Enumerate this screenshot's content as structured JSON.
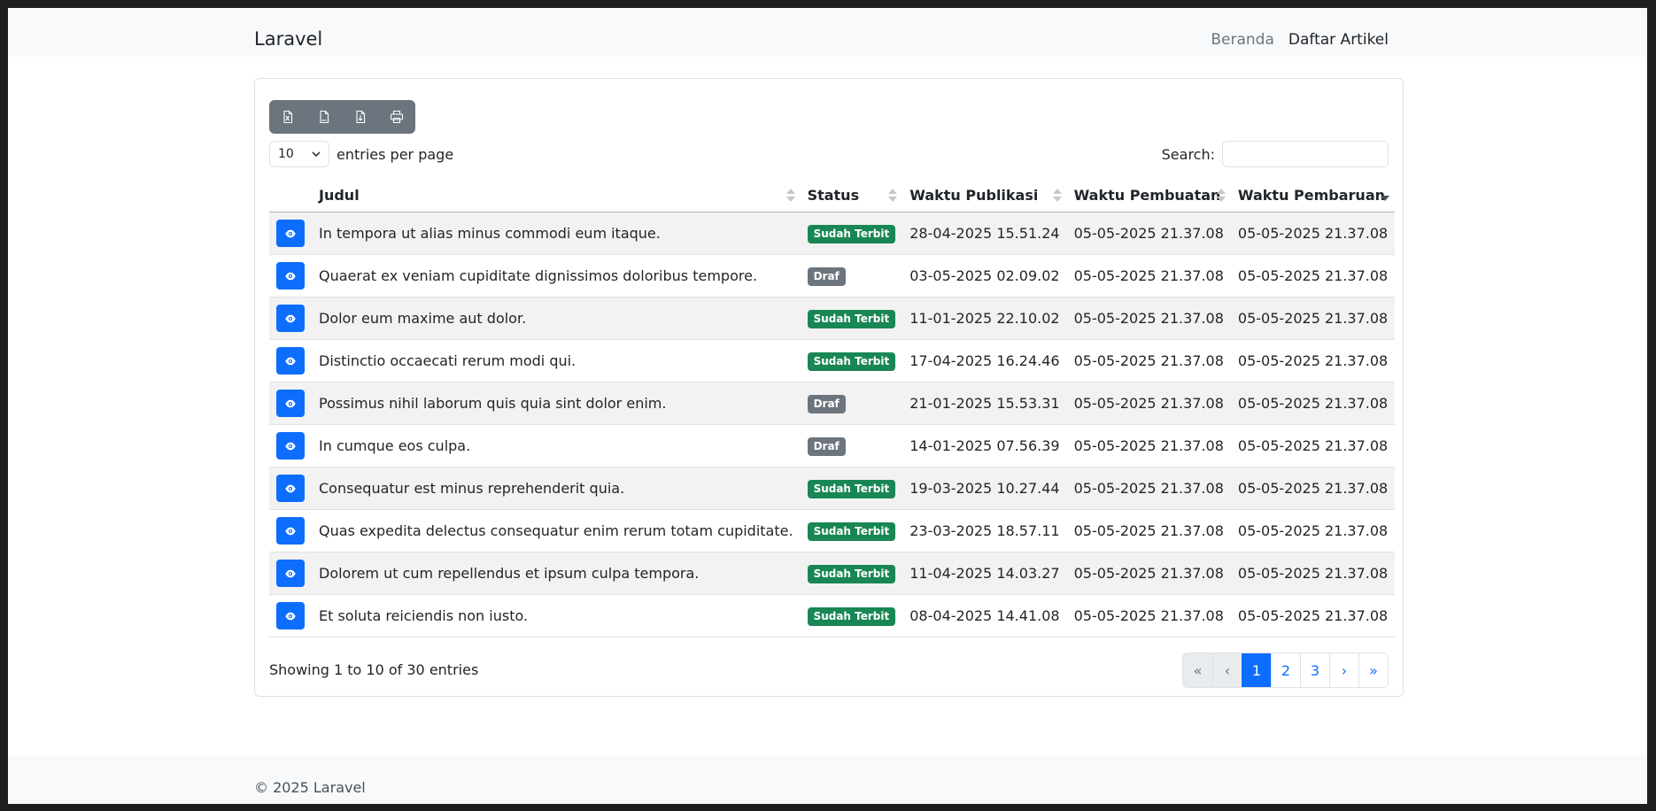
{
  "navbar": {
    "brand": "Laravel",
    "links": [
      {
        "label": "Beranda",
        "active": false
      },
      {
        "label": "Daftar Artikel",
        "active": true
      }
    ]
  },
  "toolbar": {
    "buttons": [
      {
        "icon": "excel-file-icon"
      },
      {
        "icon": "csv-file-icon"
      },
      {
        "icon": "pdf-file-icon"
      },
      {
        "icon": "print-icon"
      }
    ]
  },
  "length": {
    "value": "10",
    "label": "entries per page"
  },
  "search": {
    "label": "Search:",
    "value": "",
    "placeholder": ""
  },
  "table": {
    "columns": [
      {
        "label": "",
        "sortable": false
      },
      {
        "label": "Judul",
        "sortable": true
      },
      {
        "label": "Status",
        "sortable": true
      },
      {
        "label": "Waktu Publikasi",
        "sortable": true
      },
      {
        "label": "Waktu Pembuatan",
        "sortable": true
      },
      {
        "label": "Waktu Pembaruan",
        "sortable": true,
        "sorted": "desc"
      }
    ],
    "rows": [
      {
        "judul": "In tempora ut alias minus commodi eum itaque.",
        "status": "Sudah Terbit",
        "publikasi": "28-04-2025 15.51.24",
        "pembuatan": "05-05-2025 21.37.08",
        "pembaruan": "05-05-2025 21.37.08"
      },
      {
        "judul": "Quaerat ex veniam cupiditate dignissimos doloribus tempore.",
        "status": "Draf",
        "publikasi": "03-05-2025 02.09.02",
        "pembuatan": "05-05-2025 21.37.08",
        "pembaruan": "05-05-2025 21.37.08"
      },
      {
        "judul": "Dolor eum maxime aut dolor.",
        "status": "Sudah Terbit",
        "publikasi": "11-01-2025 22.10.02",
        "pembuatan": "05-05-2025 21.37.08",
        "pembaruan": "05-05-2025 21.37.08"
      },
      {
        "judul": "Distinctio occaecati rerum modi qui.",
        "status": "Sudah Terbit",
        "publikasi": "17-04-2025 16.24.46",
        "pembuatan": "05-05-2025 21.37.08",
        "pembaruan": "05-05-2025 21.37.08"
      },
      {
        "judul": "Possimus nihil laborum quis quia sint dolor enim.",
        "status": "Draf",
        "publikasi": "21-01-2025 15.53.31",
        "pembuatan": "05-05-2025 21.37.08",
        "pembaruan": "05-05-2025 21.37.08"
      },
      {
        "judul": "In cumque eos culpa.",
        "status": "Draf",
        "publikasi": "14-01-2025 07.56.39",
        "pembuatan": "05-05-2025 21.37.08",
        "pembaruan": "05-05-2025 21.37.08"
      },
      {
        "judul": "Consequatur est minus reprehenderit quia.",
        "status": "Sudah Terbit",
        "publikasi": "19-03-2025 10.27.44",
        "pembuatan": "05-05-2025 21.37.08",
        "pembaruan": "05-05-2025 21.37.08"
      },
      {
        "judul": "Quas expedita delectus consequatur enim rerum totam cupiditate.",
        "status": "Sudah Terbit",
        "publikasi": "23-03-2025 18.57.11",
        "pembuatan": "05-05-2025 21.37.08",
        "pembaruan": "05-05-2025 21.37.08"
      },
      {
        "judul": "Dolorem ut cum repellendus et ipsum culpa tempora.",
        "status": "Sudah Terbit",
        "publikasi": "11-04-2025 14.03.27",
        "pembuatan": "05-05-2025 21.37.08",
        "pembaruan": "05-05-2025 21.37.08"
      },
      {
        "judul": "Et soluta reiciendis non iusto.",
        "status": "Sudah Terbit",
        "publikasi": "08-04-2025 14.41.08",
        "pembuatan": "05-05-2025 21.37.08",
        "pembaruan": "05-05-2025 21.37.08"
      }
    ]
  },
  "status_colors": {
    "Sudah Terbit": "#198754",
    "Draf": "#6c757d"
  },
  "info": "Showing 1 to 10 of 30 entries",
  "pagination": [
    {
      "label": "«",
      "state": "disabled"
    },
    {
      "label": "‹",
      "state": "disabled"
    },
    {
      "label": "1",
      "state": "active"
    },
    {
      "label": "2",
      "state": "normal"
    },
    {
      "label": "3",
      "state": "normal"
    },
    {
      "label": "›",
      "state": "normal"
    },
    {
      "label": "»",
      "state": "normal"
    }
  ],
  "footer": {
    "copyright": "© 2025 Laravel"
  }
}
